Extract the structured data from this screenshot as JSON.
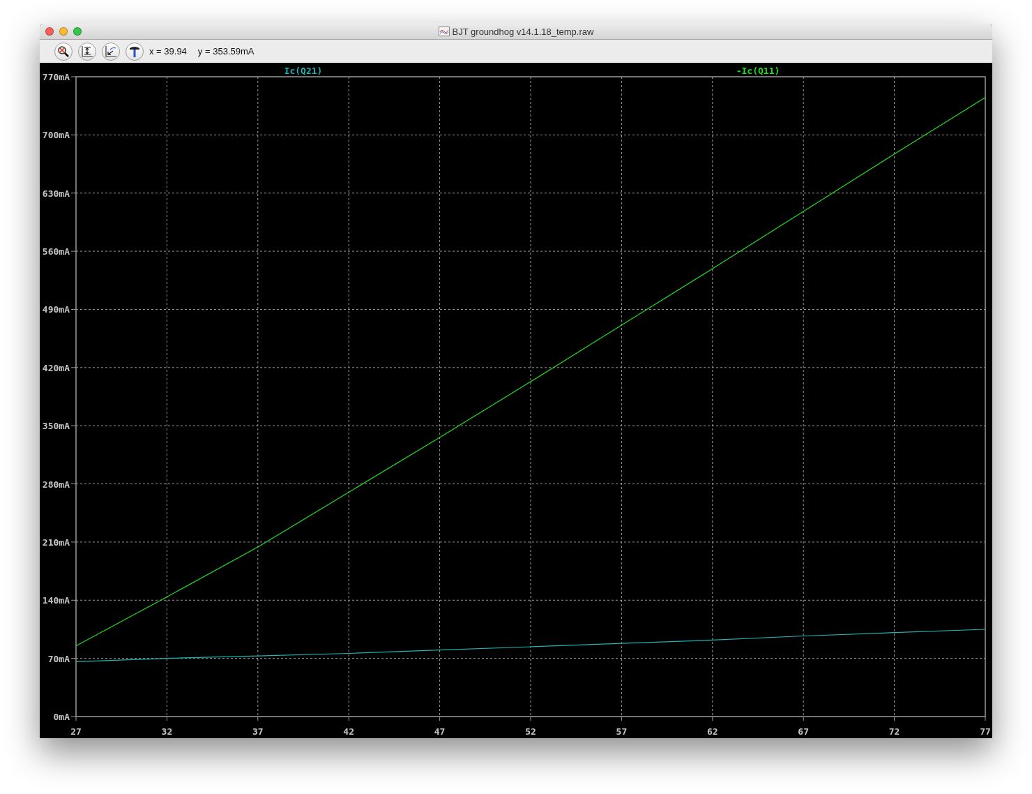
{
  "window": {
    "title": "BJT groundhog v14.1.18_temp.raw"
  },
  "toolbar": {
    "cursor_x": "x = 39.94",
    "cursor_y": "y = 353.59mA"
  },
  "plot": {
    "chart_data": {
      "type": "line",
      "x": [
        27,
        32,
        37,
        42,
        47,
        52,
        57,
        62,
        67,
        72,
        77
      ],
      "series": [
        {
          "name": "Ic(Q21)",
          "color": "#1fb3b3",
          "values": [
            66,
            70,
            73,
            76,
            80,
            84,
            88,
            92,
            97,
            101,
            105
          ]
        },
        {
          "name": "-Ic(Q11)",
          "color": "#22dd22",
          "values": [
            85,
            144,
            204,
            270,
            336,
            403,
            471,
            539,
            608,
            677,
            745
          ]
        }
      ],
      "grid": true,
      "xlim": [
        27,
        77
      ],
      "ylim": [
        0,
        770
      ],
      "xticks": [
        27,
        32,
        37,
        42,
        47,
        52,
        57,
        62,
        67,
        72,
        77
      ],
      "yticks": [
        {
          "value": 0,
          "label": "0mA"
        },
        {
          "value": 70,
          "label": "70mA"
        },
        {
          "value": 140,
          "label": "140mA"
        },
        {
          "value": 210,
          "label": "210mA"
        },
        {
          "value": 280,
          "label": "280mA"
        },
        {
          "value": 350,
          "label": "350mA"
        },
        {
          "value": 420,
          "label": "420mA"
        },
        {
          "value": 490,
          "label": "490mA"
        },
        {
          "value": 560,
          "label": "560mA"
        },
        {
          "value": 630,
          "label": "630mA"
        },
        {
          "value": 700,
          "label": "700mA"
        },
        {
          "value": 770,
          "label": "770mA"
        }
      ]
    }
  }
}
